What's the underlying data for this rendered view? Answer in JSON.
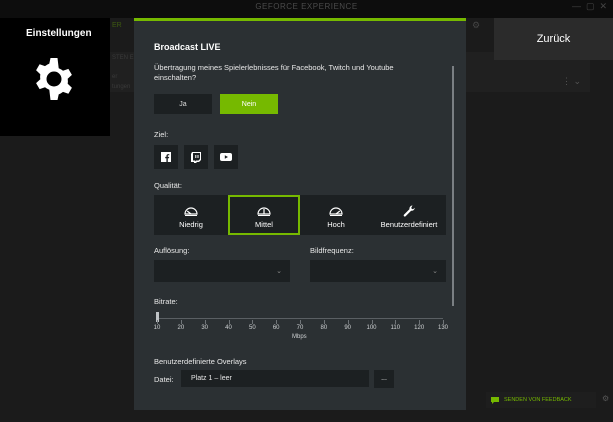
{
  "app": {
    "title": "GEFORCE EXPERIENCE"
  },
  "background": {
    "tab_hint": "ER",
    "row_hint": "STEN E",
    "mini1": "er",
    "mini2": "tungen",
    "menu_dots": "⋮",
    "menu_caret": "⌄"
  },
  "settings": {
    "title": "Einstellungen",
    "icon": "gear-icon"
  },
  "back_button": {
    "label": "Zurück"
  },
  "broadcast": {
    "title": "Broadcast LIVE",
    "question": "Übertragung meines Spielerlebnisses für Facebook, Twitch und Youtube einschalten?",
    "yes_label": "Ja",
    "no_label": "Nein",
    "selected": "Nein"
  },
  "target": {
    "label": "Ziel:",
    "platforms": [
      "facebook-icon",
      "twitch-icon",
      "youtube-icon"
    ]
  },
  "quality": {
    "label": "Qualität:",
    "options": [
      "Niedrig",
      "Mittel",
      "Hoch",
      "Benutzerdefiniert"
    ],
    "selected": "Mittel"
  },
  "resolution": {
    "label": "Auflösung:",
    "value": ""
  },
  "framerate": {
    "label": "Bildfrequenz:",
    "value": ""
  },
  "bitrate": {
    "label": "Bitrate:",
    "ticks": [
      "10",
      "20",
      "30",
      "40",
      "50",
      "60",
      "70",
      "80",
      "90",
      "100",
      "110",
      "120",
      "130"
    ],
    "unit": "Mbps",
    "value": 10
  },
  "overlays": {
    "label": "Benutzerdefinierte Overlays",
    "file_label": "Datei:",
    "file_value": "Platz 1 – leer",
    "browse_label": "..."
  },
  "feedback": {
    "label": "SENDEN VON FEEDBACK",
    "icon": "chat-icon"
  },
  "colors": {
    "accent": "#76b900",
    "panel": "#2b3033",
    "control": "#1c2022"
  }
}
